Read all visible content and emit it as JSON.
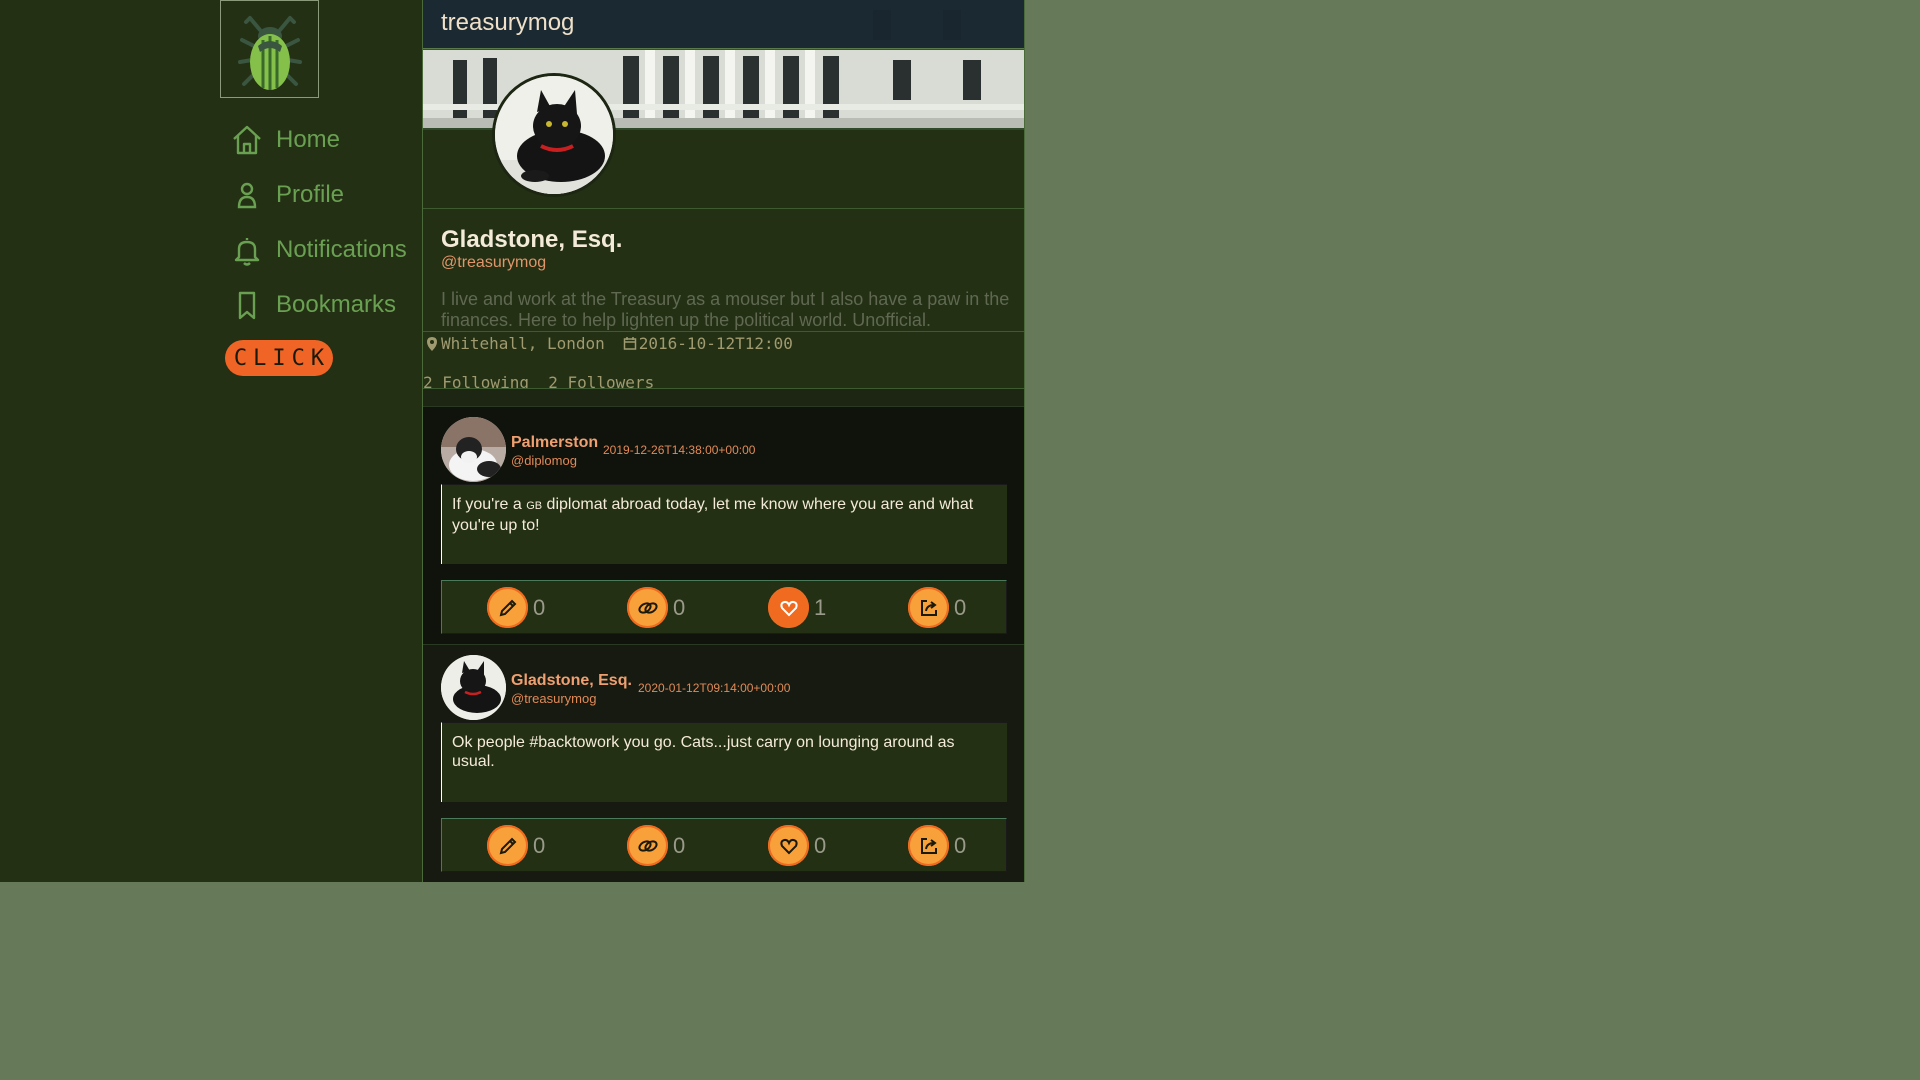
{
  "sidebar": {
    "logo_icon": "beetle-icon",
    "items": [
      {
        "label": "Home",
        "icon": "home-icon"
      },
      {
        "label": "Profile",
        "icon": "user-icon"
      },
      {
        "label": "Notifications",
        "icon": "bell-icon"
      },
      {
        "label": "Bookmarks",
        "icon": "bookmark-icon"
      }
    ],
    "click_label": "CLICK"
  },
  "header": {
    "title": "treasurymog"
  },
  "profile": {
    "name": "Gladstone, Esq.",
    "handle": "@treasurymog",
    "bio": "I live and work at the Treasury as a mouser but I also have a paw in the finances. Here to help lighten up the political world. Unofficial.",
    "location": "Whitehall, London",
    "joined": "2016-10-12T12:00",
    "following_text": "2 Following",
    "followers_text": "2 Followers"
  },
  "posts": [
    {
      "author": "Palmerston",
      "handle": "@diplomog",
      "time": "2019-12-26T14:38:00+00:00",
      "body_pre": "If you're a ",
      "body_small": "GB",
      "body_post": " diplomat abroad today, let me know where you are and what you're up to!",
      "replies": "0",
      "reposts": "0",
      "likes": "1",
      "shares": "0",
      "liked": true
    },
    {
      "author": "Gladstone, Esq.",
      "handle": "@treasurymog",
      "time": "2020-01-12T09:14:00+00:00",
      "body": "Ok people #backtowork you go. Cats...just carry on lounging around as usual.",
      "replies": "0",
      "reposts": "0",
      "likes": "0",
      "shares": "0",
      "liked": false
    }
  ],
  "colors": {
    "accent": "#f06425",
    "action_circle": "#f8a03a",
    "nav_text": "#6aa052",
    "panel": "#233014"
  }
}
